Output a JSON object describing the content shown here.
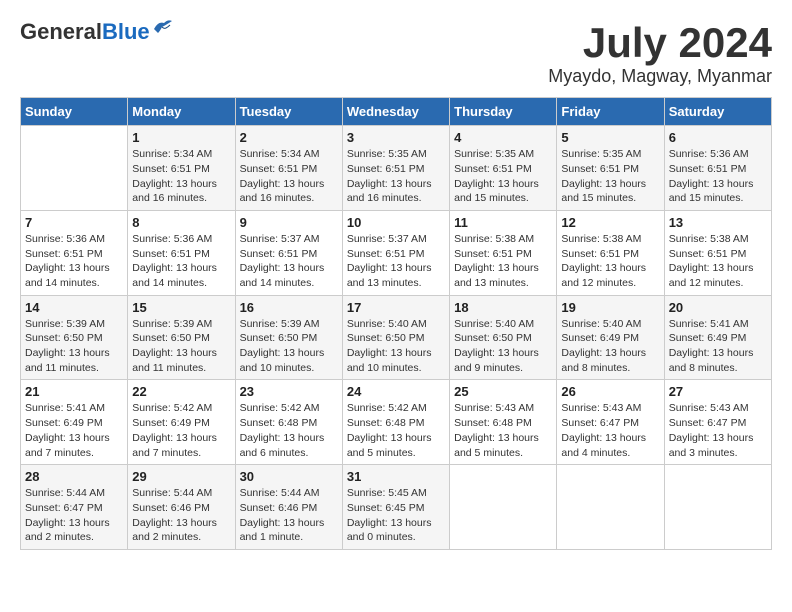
{
  "logo": {
    "general": "General",
    "blue": "Blue"
  },
  "title": "July 2024",
  "location": "Myaydo, Magway, Myanmar",
  "days_of_week": [
    "Sunday",
    "Monday",
    "Tuesday",
    "Wednesday",
    "Thursday",
    "Friday",
    "Saturday"
  ],
  "weeks": [
    [
      {
        "day": "",
        "sunrise": "",
        "sunset": "",
        "daylight": ""
      },
      {
        "day": "1",
        "sunrise": "Sunrise: 5:34 AM",
        "sunset": "Sunset: 6:51 PM",
        "daylight": "Daylight: 13 hours and 16 minutes."
      },
      {
        "day": "2",
        "sunrise": "Sunrise: 5:34 AM",
        "sunset": "Sunset: 6:51 PM",
        "daylight": "Daylight: 13 hours and 16 minutes."
      },
      {
        "day": "3",
        "sunrise": "Sunrise: 5:35 AM",
        "sunset": "Sunset: 6:51 PM",
        "daylight": "Daylight: 13 hours and 16 minutes."
      },
      {
        "day": "4",
        "sunrise": "Sunrise: 5:35 AM",
        "sunset": "Sunset: 6:51 PM",
        "daylight": "Daylight: 13 hours and 15 minutes."
      },
      {
        "day": "5",
        "sunrise": "Sunrise: 5:35 AM",
        "sunset": "Sunset: 6:51 PM",
        "daylight": "Daylight: 13 hours and 15 minutes."
      },
      {
        "day": "6",
        "sunrise": "Sunrise: 5:36 AM",
        "sunset": "Sunset: 6:51 PM",
        "daylight": "Daylight: 13 hours and 15 minutes."
      }
    ],
    [
      {
        "day": "7",
        "sunrise": "Sunrise: 5:36 AM",
        "sunset": "Sunset: 6:51 PM",
        "daylight": "Daylight: 13 hours and 14 minutes."
      },
      {
        "day": "8",
        "sunrise": "Sunrise: 5:36 AM",
        "sunset": "Sunset: 6:51 PM",
        "daylight": "Daylight: 13 hours and 14 minutes."
      },
      {
        "day": "9",
        "sunrise": "Sunrise: 5:37 AM",
        "sunset": "Sunset: 6:51 PM",
        "daylight": "Daylight: 13 hours and 14 minutes."
      },
      {
        "day": "10",
        "sunrise": "Sunrise: 5:37 AM",
        "sunset": "Sunset: 6:51 PM",
        "daylight": "Daylight: 13 hours and 13 minutes."
      },
      {
        "day": "11",
        "sunrise": "Sunrise: 5:38 AM",
        "sunset": "Sunset: 6:51 PM",
        "daylight": "Daylight: 13 hours and 13 minutes."
      },
      {
        "day": "12",
        "sunrise": "Sunrise: 5:38 AM",
        "sunset": "Sunset: 6:51 PM",
        "daylight": "Daylight: 13 hours and 12 minutes."
      },
      {
        "day": "13",
        "sunrise": "Sunrise: 5:38 AM",
        "sunset": "Sunset: 6:51 PM",
        "daylight": "Daylight: 13 hours and 12 minutes."
      }
    ],
    [
      {
        "day": "14",
        "sunrise": "Sunrise: 5:39 AM",
        "sunset": "Sunset: 6:50 PM",
        "daylight": "Daylight: 13 hours and 11 minutes."
      },
      {
        "day": "15",
        "sunrise": "Sunrise: 5:39 AM",
        "sunset": "Sunset: 6:50 PM",
        "daylight": "Daylight: 13 hours and 11 minutes."
      },
      {
        "day": "16",
        "sunrise": "Sunrise: 5:39 AM",
        "sunset": "Sunset: 6:50 PM",
        "daylight": "Daylight: 13 hours and 10 minutes."
      },
      {
        "day": "17",
        "sunrise": "Sunrise: 5:40 AM",
        "sunset": "Sunset: 6:50 PM",
        "daylight": "Daylight: 13 hours and 10 minutes."
      },
      {
        "day": "18",
        "sunrise": "Sunrise: 5:40 AM",
        "sunset": "Sunset: 6:50 PM",
        "daylight": "Daylight: 13 hours and 9 minutes."
      },
      {
        "day": "19",
        "sunrise": "Sunrise: 5:40 AM",
        "sunset": "Sunset: 6:49 PM",
        "daylight": "Daylight: 13 hours and 8 minutes."
      },
      {
        "day": "20",
        "sunrise": "Sunrise: 5:41 AM",
        "sunset": "Sunset: 6:49 PM",
        "daylight": "Daylight: 13 hours and 8 minutes."
      }
    ],
    [
      {
        "day": "21",
        "sunrise": "Sunrise: 5:41 AM",
        "sunset": "Sunset: 6:49 PM",
        "daylight": "Daylight: 13 hours and 7 minutes."
      },
      {
        "day": "22",
        "sunrise": "Sunrise: 5:42 AM",
        "sunset": "Sunset: 6:49 PM",
        "daylight": "Daylight: 13 hours and 7 minutes."
      },
      {
        "day": "23",
        "sunrise": "Sunrise: 5:42 AM",
        "sunset": "Sunset: 6:48 PM",
        "daylight": "Daylight: 13 hours and 6 minutes."
      },
      {
        "day": "24",
        "sunrise": "Sunrise: 5:42 AM",
        "sunset": "Sunset: 6:48 PM",
        "daylight": "Daylight: 13 hours and 5 minutes."
      },
      {
        "day": "25",
        "sunrise": "Sunrise: 5:43 AM",
        "sunset": "Sunset: 6:48 PM",
        "daylight": "Daylight: 13 hours and 5 minutes."
      },
      {
        "day": "26",
        "sunrise": "Sunrise: 5:43 AM",
        "sunset": "Sunset: 6:47 PM",
        "daylight": "Daylight: 13 hours and 4 minutes."
      },
      {
        "day": "27",
        "sunrise": "Sunrise: 5:43 AM",
        "sunset": "Sunset: 6:47 PM",
        "daylight": "Daylight: 13 hours and 3 minutes."
      }
    ],
    [
      {
        "day": "28",
        "sunrise": "Sunrise: 5:44 AM",
        "sunset": "Sunset: 6:47 PM",
        "daylight": "Daylight: 13 hours and 2 minutes."
      },
      {
        "day": "29",
        "sunrise": "Sunrise: 5:44 AM",
        "sunset": "Sunset: 6:46 PM",
        "daylight": "Daylight: 13 hours and 2 minutes."
      },
      {
        "day": "30",
        "sunrise": "Sunrise: 5:44 AM",
        "sunset": "Sunset: 6:46 PM",
        "daylight": "Daylight: 13 hours and 1 minute."
      },
      {
        "day": "31",
        "sunrise": "Sunrise: 5:45 AM",
        "sunset": "Sunset: 6:45 PM",
        "daylight": "Daylight: 13 hours and 0 minutes."
      },
      {
        "day": "",
        "sunrise": "",
        "sunset": "",
        "daylight": ""
      },
      {
        "day": "",
        "sunrise": "",
        "sunset": "",
        "daylight": ""
      },
      {
        "day": "",
        "sunrise": "",
        "sunset": "",
        "daylight": ""
      }
    ]
  ]
}
